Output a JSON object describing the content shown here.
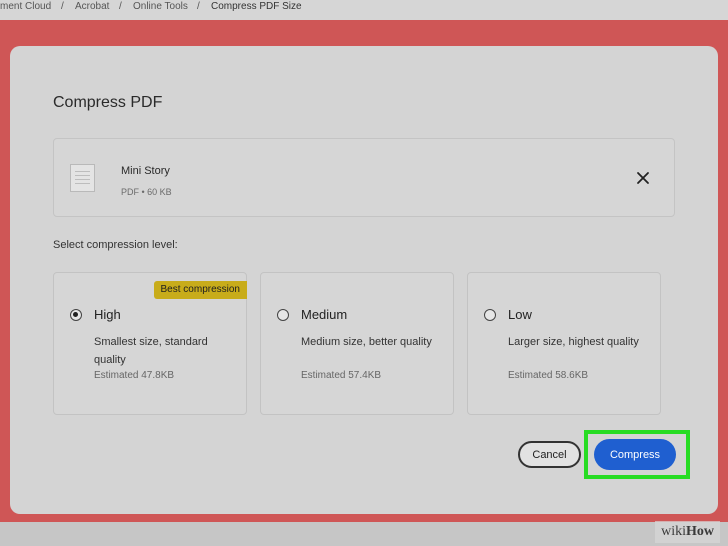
{
  "breadcrumb": {
    "items": [
      "ment Cloud",
      "Acrobat",
      "Online Tools"
    ],
    "current": "Compress PDF Size",
    "separator": "/"
  },
  "dialog": {
    "title": "Compress PDF",
    "file": {
      "name": "Mini Story",
      "meta": "PDF • 60 KB",
      "close_icon": "close-icon"
    },
    "select_label": "Select compression level:",
    "options": [
      {
        "id": "high",
        "title": "High",
        "desc": "Smallest size, standard quality",
        "estimate": "Estimated 47.8KB",
        "badge": "Best compression",
        "selected": true
      },
      {
        "id": "medium",
        "title": "Medium",
        "desc": "Medium size, better quality",
        "estimate": "Estimated 57.4KB",
        "selected": false
      },
      {
        "id": "low",
        "title": "Low",
        "desc": "Larger size, highest quality",
        "estimate": "Estimated 58.6KB",
        "selected": false
      }
    ],
    "buttons": {
      "cancel": "Cancel",
      "compress": "Compress"
    }
  },
  "watermark": {
    "prefix": "wiki",
    "suffix": "How"
  },
  "colors": {
    "backdrop": "#cf5656",
    "primary_button": "#1f5fd0",
    "badge": "#c8ac1a",
    "highlight": "#27dc23"
  }
}
